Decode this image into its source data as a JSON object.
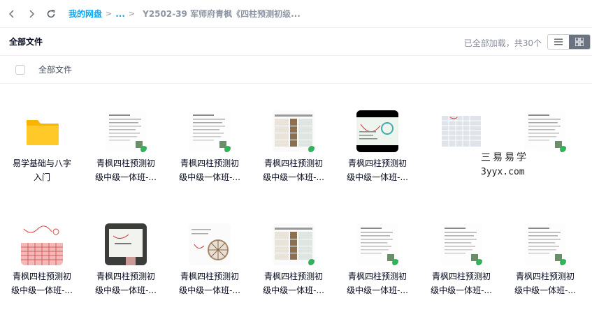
{
  "breadcrumb": {
    "root": "我的网盘",
    "sep": ">",
    "more": "...",
    "current": "Y2502-39 军师府青枫《四柱预测初级..."
  },
  "toolbar": {
    "title": "全部文件",
    "status": "已全部加载，共30个"
  },
  "list_header": {
    "label": "全部文件"
  },
  "watermark": {
    "line1": "三易易学",
    "line2": "3yyx.com"
  },
  "files": [
    {
      "line1": "易学基础与八字",
      "line2": "入门",
      "kind": "folder-icon"
    },
    {
      "line1": "青枫四柱预测初",
      "line2": "级中级一体班-...",
      "kind": "doc"
    },
    {
      "line1": "青枫四柱预测初",
      "line2": "级中级一体班-...",
      "kind": "doc"
    },
    {
      "line1": "青枫四柱预测初",
      "line2": "级中级一体班-...",
      "kind": "table"
    },
    {
      "line1": "青枫四柱预测初",
      "line2": "级中级一体班-...",
      "kind": "video"
    },
    {
      "line1": "",
      "line2": "",
      "kind": "grid"
    },
    {
      "line1": "",
      "line2": "",
      "kind": "doc"
    },
    {
      "line1": "青枫四柱预测初",
      "line2": "级中级一体班-...",
      "kind": "redgrid"
    },
    {
      "line1": "青枫四柱预测初",
      "line2": "级中级一体班-...",
      "kind": "whiteboard"
    },
    {
      "line1": "青枫四柱预测初",
      "line2": "级中级一体班-...",
      "kind": "wheel"
    },
    {
      "line1": "青枫四柱预测初",
      "line2": "级中级一体班-...",
      "kind": "table"
    },
    {
      "line1": "青枫四柱预测初",
      "line2": "级中级一体班-...",
      "kind": "doc"
    },
    {
      "line1": "青枫四柱预测初",
      "line2": "级中级一体班-...",
      "kind": "doc"
    },
    {
      "line1": "青枫四柱预测初",
      "line2": "级中级一体班-...",
      "kind": "doc"
    }
  ]
}
